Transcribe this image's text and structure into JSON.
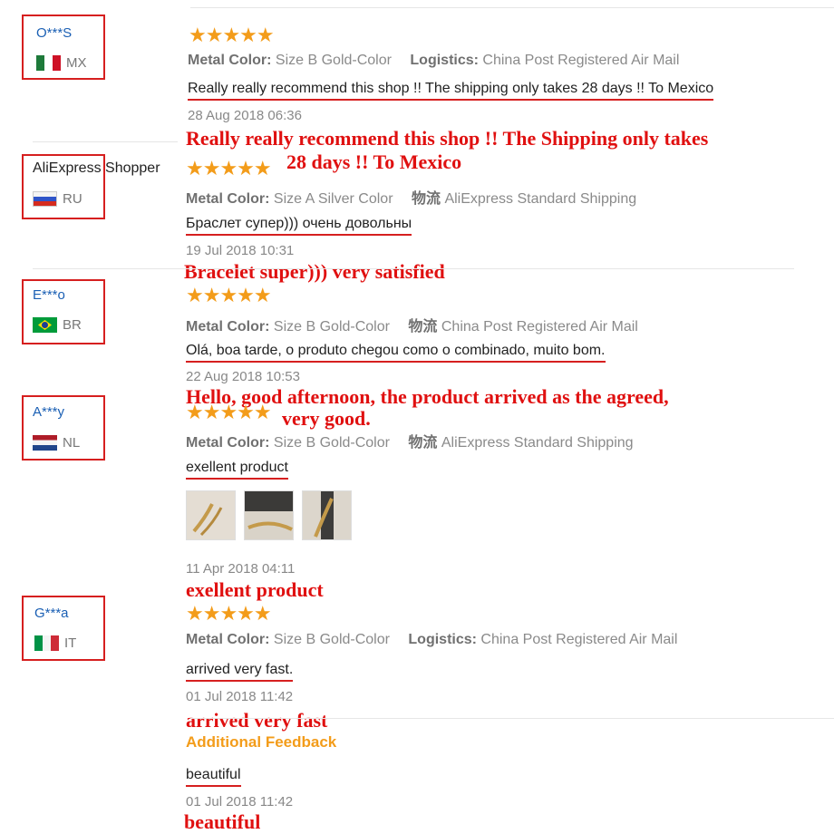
{
  "reviews": [
    {
      "user": "O***S",
      "country": "MX",
      "rating": "★★★★★",
      "meta1_key": "Metal Color:",
      "meta1_val": "Size B Gold-Color",
      "meta2_key": "Logistics:",
      "meta2_val": "China Post Registered Air Mail",
      "text": "Really really recommend this shop !! The shipping only takes 28 days !! To Mexico",
      "date": "28 Aug 2018 06:36",
      "translation_line1": "Really really recommend this shop !! The Shipping only takes",
      "translation_line2": "28 days !! To Mexico"
    },
    {
      "user": "AliExpress Shopper",
      "country": "RU",
      "rating": "★★★★★",
      "meta1_key": "Metal Color:",
      "meta1_val": "Size A Silver Color",
      "meta2_key": "物流",
      "meta2_val": "AliExpress Standard Shipping",
      "text": "Браслет супер))) очень довольны",
      "date": "19 Jul 2018 10:31",
      "translation_line1": "Bracelet super))) very satisfied"
    },
    {
      "user": "E***o",
      "country": "BR",
      "rating": "★★★★★",
      "meta1_key": "Metal Color:",
      "meta1_val": "Size B Gold-Color",
      "meta2_key": "物流",
      "meta2_val": "China Post Registered Air Mail",
      "text": "Olá, boa tarde, o produto chegou como o combinado, muito bom.",
      "date": "22 Aug 2018 10:53",
      "translation_line1": "Hello, good afternoon, the product arrived as the agreed,",
      "translation_line2": "very good."
    },
    {
      "user": "A***y",
      "country": "NL",
      "rating": "★★★★★",
      "meta1_key": "Metal Color:",
      "meta1_val": "Size B Gold-Color",
      "meta2_key": "物流",
      "meta2_val": "AliExpress Standard Shipping",
      "text": "exellent product",
      "date": "11 Apr 2018 04:11",
      "translation_line1": "exellent product"
    },
    {
      "user": "G***a",
      "country": "IT",
      "rating": "★★★★★",
      "meta1_key": "Metal Color:",
      "meta1_val": "Size B Gold-Color",
      "meta2_key": "Logistics:",
      "meta2_val": "China Post Registered Air Mail",
      "text": "arrived very fast.",
      "date": "01 Jul 2018 11:42",
      "translation_line1": "arrived very fast",
      "additional_feedback_label": "Additional Feedback",
      "additional_text": "beautiful",
      "additional_date": "01 Jul 2018 11:42",
      "additional_translation": "beautiful"
    }
  ],
  "colors": {
    "accent_red": "#d61f1f",
    "star_orange": "#f39c1a",
    "username_blue": "#1a5fb4"
  },
  "icons": [
    "star-icon",
    "flag-mx-icon",
    "flag-ru-icon",
    "flag-br-icon",
    "flag-nl-icon",
    "flag-it-icon"
  ]
}
